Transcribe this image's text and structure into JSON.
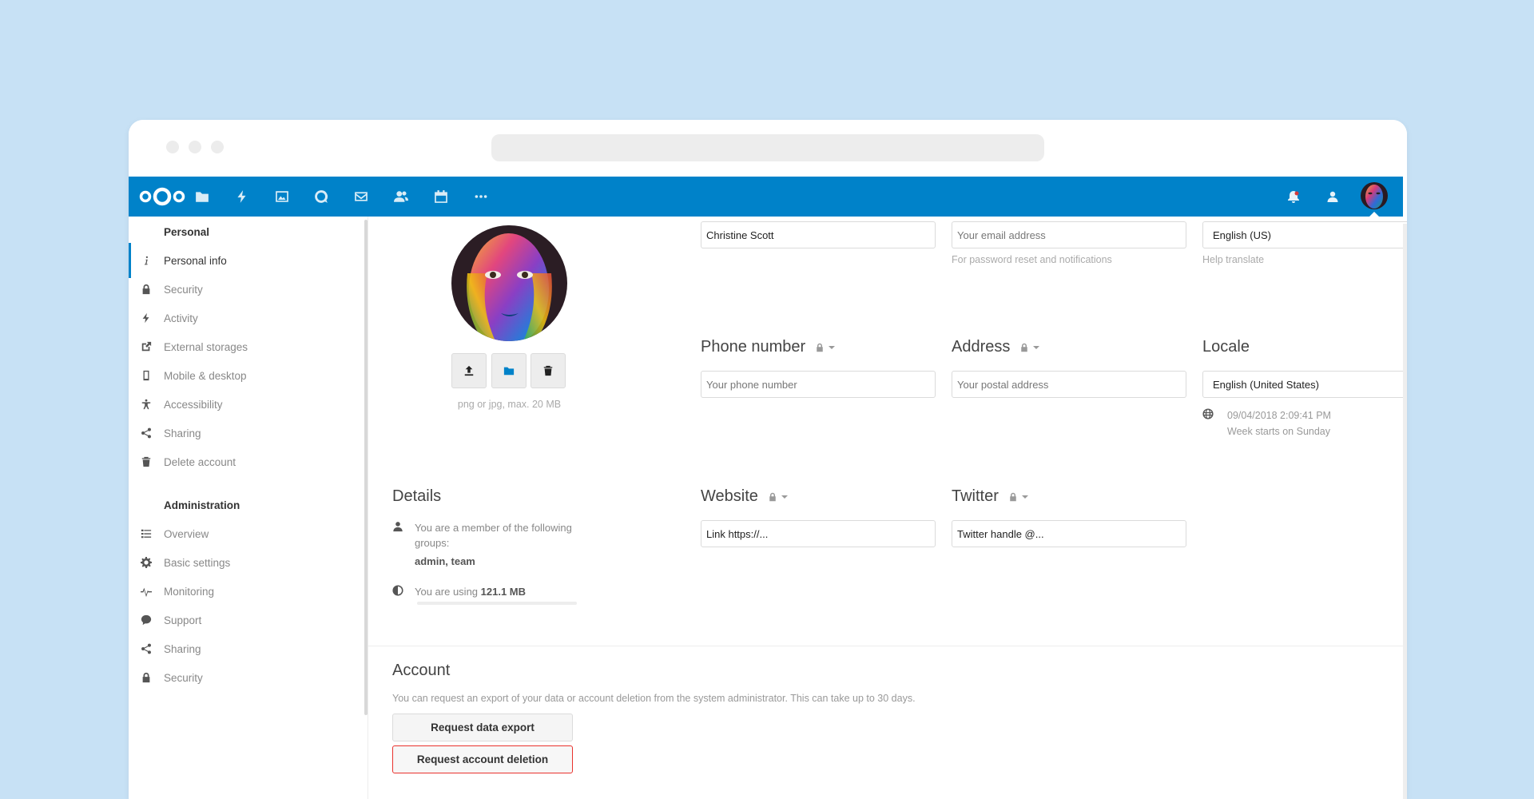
{
  "topbar": {
    "apps": [
      "files-icon",
      "activity-icon",
      "gallery-icon",
      "talk-icon",
      "mail-icon",
      "contacts-icon",
      "calendar-icon",
      "more-apps-icon"
    ],
    "right_icons": [
      "notifications-icon",
      "contacts-menu-icon",
      "user-avatar"
    ]
  },
  "sidebar": {
    "personal_heading": "Personal",
    "personal_items": [
      {
        "label": "Personal info",
        "icon": "info-icon",
        "active": true
      },
      {
        "label": "Security",
        "icon": "lock-icon"
      },
      {
        "label": "Activity",
        "icon": "activity-icon"
      },
      {
        "label": "External storages",
        "icon": "external-icon"
      },
      {
        "label": "Mobile & desktop",
        "icon": "phone-icon"
      },
      {
        "label": "Accessibility",
        "icon": "accessibility-icon"
      },
      {
        "label": "Sharing",
        "icon": "share-icon"
      },
      {
        "label": "Delete account",
        "icon": "trash-icon"
      }
    ],
    "admin_heading": "Administration",
    "admin_items": [
      {
        "label": "Overview",
        "icon": "list-icon"
      },
      {
        "label": "Basic settings",
        "icon": "gear-icon"
      },
      {
        "label": "Monitoring",
        "icon": "monitoring-icon"
      },
      {
        "label": "Support",
        "icon": "support-icon"
      },
      {
        "label": "Sharing",
        "icon": "share-icon"
      },
      {
        "label": "Security",
        "icon": "lock-icon"
      }
    ]
  },
  "profile": {
    "pic_hint": "png or jpg, max. 20 MB",
    "name_value": "Christine Scott",
    "email_placeholder": "Your email address",
    "email_hint": "For password reset and notifications",
    "language_value": "English (US)",
    "language_hint": "Help translate",
    "phone_label": "Phone number",
    "phone_placeholder": "Your phone number",
    "address_label": "Address",
    "address_placeholder": "Your postal address",
    "locale_label": "Locale",
    "locale_value": "English (United States)",
    "locale_time": "09/04/2018 2:09:41 PM",
    "locale_week": "Week starts on Sunday",
    "details_label": "Details",
    "groups_text": "You are a member of the following groups:",
    "groups_value": "admin, team",
    "usage_prefix": "You are using ",
    "usage_value": "121.1 MB",
    "website_label": "Website",
    "website_placeholder": "Link https://...",
    "twitter_label": "Twitter",
    "twitter_placeholder": "Twitter handle @..."
  },
  "account": {
    "title": "Account",
    "description": "You can request an export of your data or account deletion from the system administrator. This can take up to 30 days.",
    "export_label": "Request data export",
    "delete_label": "Request account deletion"
  },
  "colors": {
    "brand": "#0082c9",
    "danger": "#e9322d",
    "background": "#c7e1f5"
  }
}
